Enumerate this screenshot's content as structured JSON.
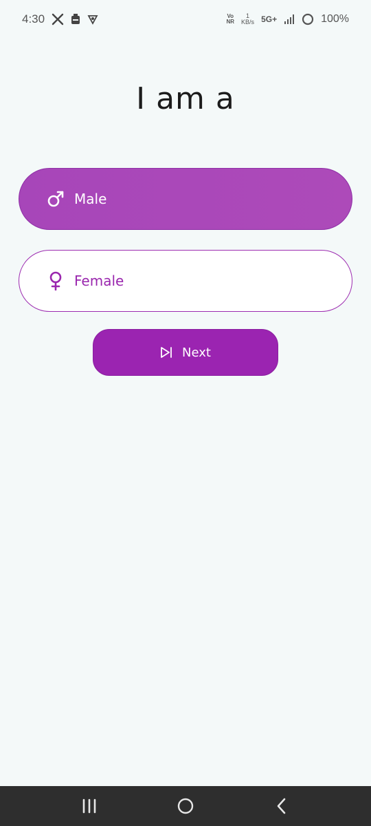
{
  "status_bar": {
    "time": "4:30",
    "volte_top": "Vo",
    "volte_bottom": "NR",
    "speed_value": "1",
    "speed_unit": "KB/s",
    "network_type": "5G+",
    "battery": "100%",
    "icons": [
      "x-logo-icon",
      "battery-saver-icon",
      "vpn-shield-icon",
      "signal-icon",
      "battery-ring-icon"
    ]
  },
  "page": {
    "title": "I am a"
  },
  "options": [
    {
      "label": "Male",
      "icon": "male-symbol-icon",
      "selected": true
    },
    {
      "label": "Female",
      "icon": "female-symbol-icon",
      "selected": false
    }
  ],
  "next_button": {
    "label": "Next",
    "icon": "skip-next-icon"
  },
  "nav_bar": {
    "icons": [
      "recent-apps-icon",
      "home-icon",
      "back-icon"
    ]
  },
  "colors": {
    "background": "#f4f9f9",
    "accent": "#9b24b1",
    "selected_fill": "#a746b9",
    "nav_bar": "#2e2e2e"
  }
}
